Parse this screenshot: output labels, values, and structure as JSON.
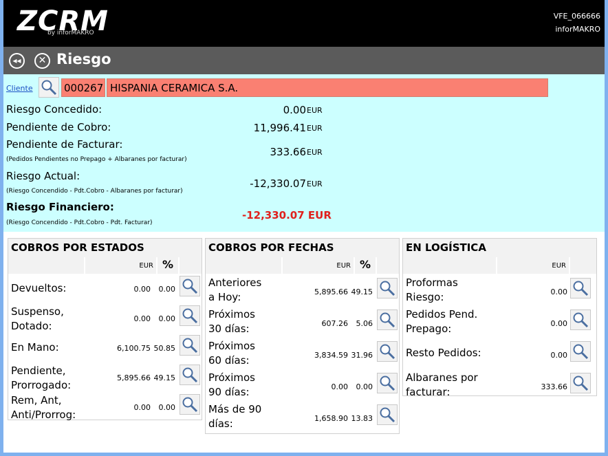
{
  "header": {
    "logo_text": "ZCRM",
    "logo_sub": "by inforMAKRO",
    "user_code": "VFE_066666",
    "user_company": "inforMAKRO"
  },
  "titlebar": {
    "back_icon": "rewind-icon",
    "close_icon": "close-icon",
    "title": "Riesgo"
  },
  "cliente": {
    "link_label": "Cliente",
    "code": "000267",
    "name": "HISPANIA CERAMICA S.A.",
    "accent": "#fa8072"
  },
  "riesgo": {
    "concedido_label": "Riesgo Concedido:",
    "concedido_value": "0.00",
    "pend_cobro_label": "Pendiente de Cobro:",
    "pend_cobro_value": "11,996.41",
    "pend_facturar_label": "Pendiente de Facturar:",
    "pend_facturar_note": "(Pedidos Pendientes no Prepago + Albaranes por facturar)",
    "pend_facturar_value": "333.66",
    "actual_label": "Riesgo Actual:",
    "actual_note": "(Riesgo Concendido - Pdt.Cobro - Albaranes por facturar)",
    "actual_value": "-12,330.07",
    "financiero_label": "Riesgo Financiero:",
    "financiero_note": "(Riesgo Concendido - Pdt.Cobro - Pdt. Facturar)",
    "financiero_value": "-12,330.07 EUR",
    "currency": "EUR",
    "negative_color": "#e0201c"
  },
  "panels": {
    "estados": {
      "title": "COBROS POR ESTADOS",
      "eur": "EUR",
      "pct": "%",
      "rows": [
        {
          "label1": "Devueltos:",
          "label2": "",
          "eur": "0.00",
          "pct": "0.00"
        },
        {
          "label1": "Suspenso,",
          "label2": "Dotado:",
          "eur": "0.00",
          "pct": "0.00"
        },
        {
          "label1": "En Mano:",
          "label2": "",
          "eur": "6,100.75",
          "pct": "50.85"
        },
        {
          "label1": "Pendiente,",
          "label2": "Prorrogado:",
          "eur": "5,895.66",
          "pct": "49.15"
        },
        {
          "label1": "Rem, Ant,",
          "label2": "Anti/Prorrog:",
          "eur": "0.00",
          "pct": "0.00"
        }
      ]
    },
    "fechas": {
      "title": "COBROS POR FECHAS",
      "eur": "EUR",
      "pct": "%",
      "rows": [
        {
          "label1": "Anteriores",
          "label2": "a Hoy:",
          "eur": "5,895.66",
          "pct": "49.15"
        },
        {
          "label1": "Próximos",
          "label2": "30 días:",
          "eur": "607.26",
          "pct": "5.06"
        },
        {
          "label1": "Próximos",
          "label2": "60 días:",
          "eur": "3,834.59",
          "pct": "31.96"
        },
        {
          "label1": "Próximos",
          "label2": "90 días:",
          "eur": "0.00",
          "pct": "0.00"
        },
        {
          "label1": "Más de 90",
          "label2": "días:",
          "eur": "1,658.90",
          "pct": "13.83"
        }
      ]
    },
    "logistica": {
      "title": "EN LOGÍSTICA",
      "eur": "EUR",
      "rows": [
        {
          "label1": "Proformas",
          "label2": "Riesgo:",
          "eur": "0.00"
        },
        {
          "label1": "Pedidos Pend.",
          "label2": "Prepago:",
          "eur": "0.00"
        },
        {
          "label1": "Resto Pedidos:",
          "label2": "",
          "eur": "0.00"
        },
        {
          "label1": "Albaranes por",
          "label2": "facturar:",
          "eur": "333.66"
        }
      ]
    }
  },
  "icons": {
    "lupa": "magnifier-icon"
  }
}
